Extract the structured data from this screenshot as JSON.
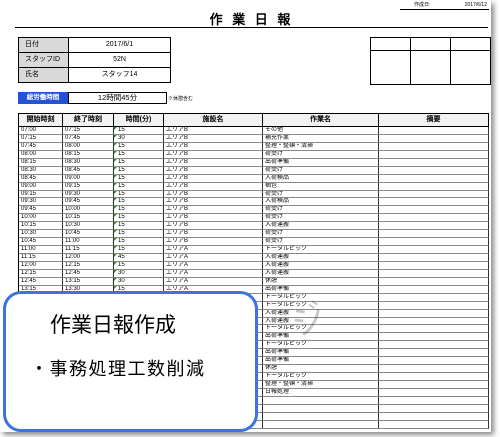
{
  "header": {
    "created_label": "作成日:",
    "created_date": "2017/6/12",
    "title": "作 業 日 報"
  },
  "info": {
    "date_label": "日付",
    "date_value": "2017/6/1",
    "staff_id_label": "スタッフID",
    "staff_id_value": "52N",
    "name_label": "氏名",
    "name_value": "スタッフ14"
  },
  "total": {
    "label": "総労働時間",
    "value": "12時間45分",
    "note": "※休憩含む"
  },
  "table": {
    "columns": [
      "開始時刻",
      "終了時刻",
      "時間(分)",
      "施設名",
      "作業名",
      "摘要"
    ],
    "rows": [
      {
        "start": "07:00",
        "end": "07:15",
        "minutes": "15",
        "area": "エリアB",
        "task": "その他"
      },
      {
        "start": "07:15",
        "end": "07:45",
        "minutes": "30",
        "area": "エリアB",
        "task": "補充作業"
      },
      {
        "start": "07:45",
        "end": "08:00",
        "minutes": "15",
        "area": "エリアB",
        "task": "整理・整頓・清掃"
      },
      {
        "start": "08:00",
        "end": "08:15",
        "minutes": "15",
        "area": "エリアB",
        "task": "荷受け"
      },
      {
        "start": "08:15",
        "end": "08:30",
        "minutes": "15",
        "area": "エリアB",
        "task": "出荷準備"
      },
      {
        "start": "08:30",
        "end": "08:45",
        "minutes": "15",
        "area": "エリアB",
        "task": "荷受け"
      },
      {
        "start": "08:45",
        "end": "09:00",
        "minutes": "15",
        "area": "エリアB",
        "task": "入荷検品"
      },
      {
        "start": "09:00",
        "end": "09:15",
        "minutes": "15",
        "area": "エリアB",
        "task": "梱包"
      },
      {
        "start": "09:15",
        "end": "09:30",
        "minutes": "15",
        "area": "エリアB",
        "task": "荷受け"
      },
      {
        "start": "09:30",
        "end": "09:45",
        "minutes": "15",
        "area": "エリアB",
        "task": "入荷検品"
      },
      {
        "start": "09:45",
        "end": "10:00",
        "minutes": "15",
        "area": "エリアB",
        "task": "荷受け"
      },
      {
        "start": "10:00",
        "end": "10:15",
        "minutes": "15",
        "area": "エリアB",
        "task": "荷受け"
      },
      {
        "start": "10:15",
        "end": "10:30",
        "minutes": "15",
        "area": "エリアB",
        "task": "入荷運搬"
      },
      {
        "start": "10:30",
        "end": "10:45",
        "minutes": "15",
        "area": "エリアB",
        "task": "荷受け"
      },
      {
        "start": "10:45",
        "end": "11:00",
        "minutes": "15",
        "area": "エリアB",
        "task": "荷受け"
      },
      {
        "start": "11:00",
        "end": "11:15",
        "minutes": "15",
        "area": "エリアA",
        "task": "トータルピック"
      },
      {
        "start": "11:15",
        "end": "12:00",
        "minutes": "45",
        "area": "エリアA",
        "task": "入荷運搬"
      },
      {
        "start": "12:00",
        "end": "12:15",
        "minutes": "15",
        "area": "エリアA",
        "task": "入荷運搬"
      },
      {
        "start": "12:15",
        "end": "12:45",
        "minutes": "30",
        "area": "エリアA",
        "task": "入荷運搬"
      },
      {
        "start": "12:45",
        "end": "13:15",
        "minutes": "30",
        "area": "エリアA",
        "task": "休憩"
      },
      {
        "start": "13:15",
        "end": "13:30",
        "minutes": "15",
        "area": "エリアA",
        "task": "出荷準備"
      },
      {
        "task": "トータルピック"
      },
      {
        "task": "トータルピック"
      },
      {
        "task": "入荷運搬"
      },
      {
        "task": "入荷運搬"
      },
      {
        "task": "トータルピック"
      },
      {
        "task": "出荷準備"
      },
      {
        "task": "トータルピック"
      },
      {
        "task": "出荷準備"
      },
      {
        "task": "出荷準備"
      },
      {
        "task": "休憩"
      },
      {
        "task": "トータルピック"
      },
      {
        "task": "整理・整頓・清掃"
      },
      {
        "task": "日報処理"
      },
      {},
      {},
      {},
      {}
    ]
  },
  "watermark": "ジ",
  "callout": {
    "title": "作業日報作成",
    "bullet": "・事務処理工数削減"
  },
  "colors": {
    "callout_border": "#3a74dc",
    "total_label_bg": "#2352d4",
    "info_label_bg": "#d9d9d9",
    "error_flag": "#1f9d3a"
  }
}
